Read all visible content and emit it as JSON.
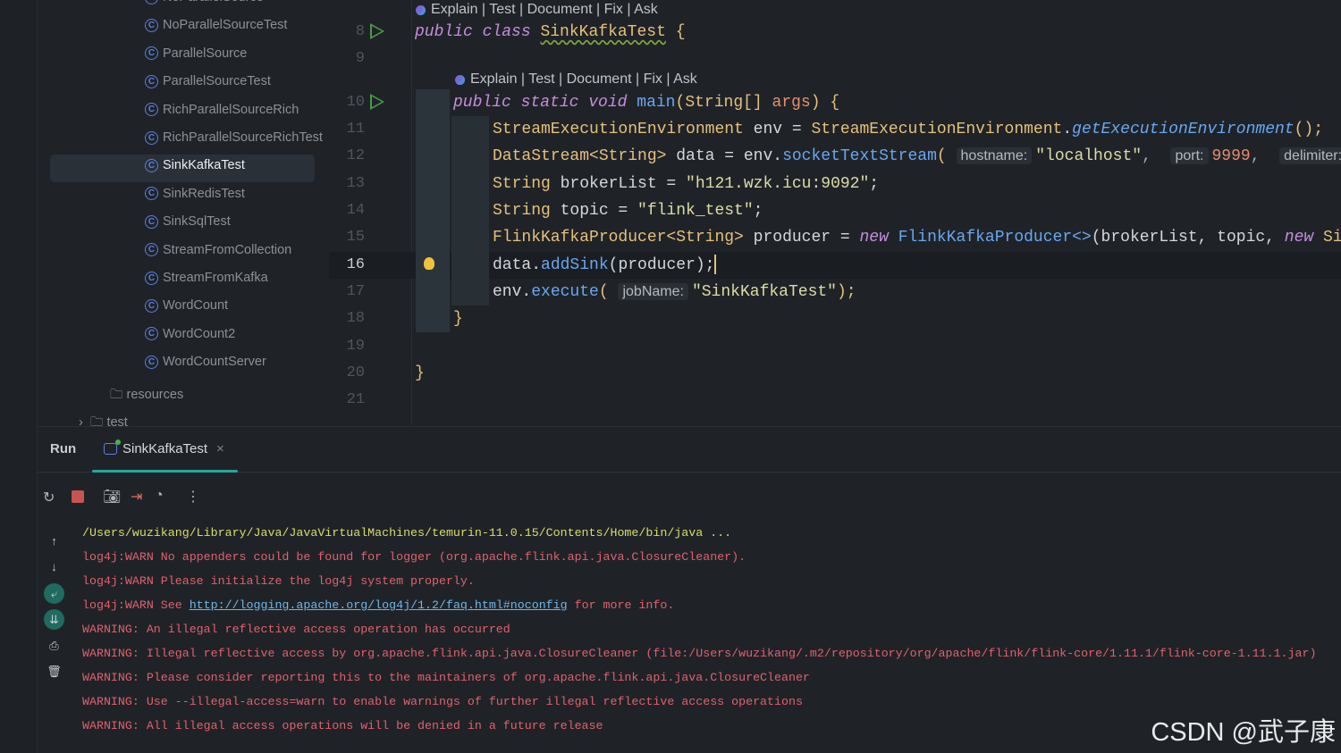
{
  "project_tree": {
    "items": [
      {
        "label": "NoParallelSource",
        "kind": "class"
      },
      {
        "label": "NoParallelSourceTest",
        "kind": "class"
      },
      {
        "label": "ParallelSource",
        "kind": "class"
      },
      {
        "label": "ParallelSourceTest",
        "kind": "class"
      },
      {
        "label": "RichParallelSourceRich",
        "kind": "class"
      },
      {
        "label": "RichParallelSourceRichTest",
        "kind": "class"
      },
      {
        "label": "SinkKafkaTest",
        "kind": "class",
        "selected": true
      },
      {
        "label": "SinkRedisTest",
        "kind": "class"
      },
      {
        "label": "SinkSqlTest",
        "kind": "class"
      },
      {
        "label": "StreamFromCollection",
        "kind": "class"
      },
      {
        "label": "StreamFromKafka",
        "kind": "class"
      },
      {
        "label": "WordCount",
        "kind": "class"
      },
      {
        "label": "WordCount2",
        "kind": "class"
      },
      {
        "label": "WordCountServer",
        "kind": "class"
      }
    ],
    "resources": "resources",
    "test": "test"
  },
  "editor": {
    "line_numbers": [
      "8",
      "9",
      "10",
      "11",
      "12",
      "13",
      "14",
      "15",
      "16",
      "17",
      "18",
      "19",
      "20",
      "21"
    ],
    "current_line": "16",
    "code_lens": "Explain | Test | Document | Fix | Ask",
    "hints": {
      "hostname": "hostname:",
      "port": "port:",
      "delimiter": "delimiter:",
      "jobName": "jobName:"
    },
    "lines": {
      "l8": [
        "public",
        "class",
        "SinkKafkaTest",
        "{"
      ],
      "l10": [
        "public",
        "static",
        "void",
        "main",
        "(",
        "String",
        "[] ",
        "args",
        ")",
        " {"
      ],
      "l11": [
        "StreamExecutionEnvironment",
        " env = ",
        "StreamExecutionEnvironment",
        ".",
        "getExecutionEnvironment",
        "();"
      ],
      "l12": [
        "DataStream<String>",
        " data = env.",
        "socketTextStream",
        "(",
        "\"localhost\"",
        ", ",
        "9999",
        ", "
      ],
      "l13": [
        "String",
        " brokerList = ",
        "\"h121.wzk.icu:9092\"",
        ";"
      ],
      "l14": [
        "String",
        " topic = ",
        "\"flink_test\"",
        ";"
      ],
      "l15": [
        "FlinkKafkaProducer<String>",
        " producer = ",
        "new",
        " ",
        "FlinkKafkaProducer<>",
        "(brokerList, topic, ",
        "new",
        " Si"
      ],
      "l16": [
        "data.",
        "addSink",
        "(producer);"
      ],
      "l17": [
        "env.",
        "execute",
        "(",
        "\"SinkKafkaTest\"",
        ");"
      ],
      "l18": "}",
      "l20": "}"
    }
  },
  "run_panel": {
    "title": "Run",
    "tab_label": "SinkKafkaTest",
    "console": [
      {
        "type": "path",
        "text": "/Users/wuzikang/Library/Java/JavaVirtualMachines/temurin-11.0.15/Contents/Home/bin/java ..."
      },
      {
        "type": "warn",
        "text": "log4j:WARN No appenders could be found for logger (org.apache.flink.api.java.ClosureCleaner)."
      },
      {
        "type": "warn",
        "text": "log4j:WARN Please initialize the log4j system properly."
      },
      {
        "type": "link",
        "pre": "log4j:WARN See ",
        "link": "http://logging.apache.org/log4j/1.2/faq.html#noconfig",
        "post": " for more info."
      },
      {
        "type": "warn",
        "text": "WARNING: An illegal reflective access operation has occurred"
      },
      {
        "type": "warn",
        "text": "WARNING: Illegal reflective access by org.apache.flink.api.java.ClosureCleaner (file:/Users/wuzikang/.m2/repository/org/apache/flink/flink-core/1.11.1/flink-core-1.11.1.jar)"
      },
      {
        "type": "warn",
        "text": "WARNING: Please consider reporting this to the maintainers of org.apache.flink.api.java.ClosureCleaner"
      },
      {
        "type": "warn",
        "text": "WARNING: Use --illegal-access=warn to enable warnings of further illegal reflective access operations"
      },
      {
        "type": "warn",
        "text": "WARNING: All illegal access operations will be denied in a future release"
      }
    ]
  },
  "watermark": "CSDN @武子康"
}
